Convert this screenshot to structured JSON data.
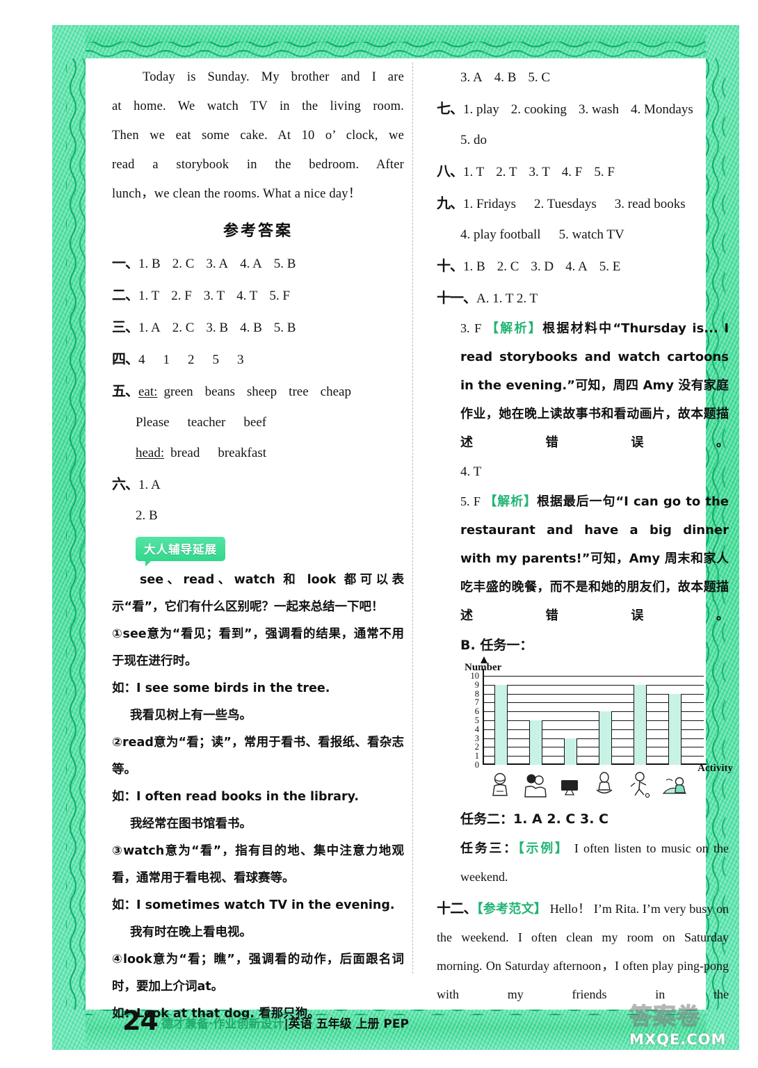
{
  "page": {
    "number": "24",
    "footer_green": "德才兼备·作业创新设计",
    "footer_black": "|英语  五年级  上册  PEP",
    "watermark_cn": "答案卷",
    "watermark_url": "MXQE.COM"
  },
  "reading_passage": {
    "lines": [
      "Today is Sunday. My brother and I are",
      "at home. We watch TV in the living room.",
      "Then we eat some cake. At 10 o’ clock, we",
      "read a storybook in the bedroom. After",
      "lunch，we clean the rooms. What a nice day！"
    ]
  },
  "answer_key": {
    "title": "参考答案",
    "sections": [
      {
        "num": "一、",
        "items": [
          "1. B",
          "2. C",
          "3. A",
          "4. A",
          "5. B"
        ]
      },
      {
        "num": "二、",
        "items": [
          "1. T",
          "2. F",
          "3. T",
          "4. T",
          "5. F"
        ]
      },
      {
        "num": "三、",
        "items": [
          "1. A",
          "2. C",
          "3. B",
          "4. B",
          "5. B"
        ]
      },
      {
        "num": "四、",
        "items": [
          "4",
          "1",
          "2",
          "5",
          "3"
        ]
      }
    ],
    "section_five": {
      "num": "五、",
      "line1_key": "eat:",
      "line1_words": [
        "green",
        "beans",
        "sheep",
        "tree",
        "cheap"
      ],
      "line2_words": [
        "Please",
        "teacher",
        "beef"
      ],
      "line3_key": "head:",
      "line3_words": [
        "bread",
        "breakfast"
      ]
    },
    "section_six": {
      "num": "六、",
      "item1": "1. A",
      "item2": "2. B"
    }
  },
  "tip_box": {
    "banner": "大人辅导延展",
    "paragraphs": [
      "see、read、watch 和 look 都可以表示“看”，它们有什么区别呢？一起来总结一下吧！",
      "①see意为“看见；看到”，强调看的结果，通常不用于现在进行时。",
      "如：I see some birds in the tree.",
      "我看见树上有一些鸟。",
      "②read意为“看；读”，常用于看书、看报纸、看杂志等。",
      "如：I often read books in the library.",
      "我经常在图书馆看书。",
      "③watch意为“看”，指有目的地、集中注意力地观看，通常用于看电视、看球赛等。",
      "如：I sometimes watch TV in the evening.",
      "我有时在晚上看电视。",
      "④look意为“看；瞧”，强调看的动作，后面跟名词时，要加上介词at。",
      "如：Look at that dog. 看那只狗。"
    ]
  },
  "right_column": {
    "six_cont": [
      "3. A",
      "4. B",
      "5. C"
    ],
    "sections": [
      {
        "num": "七、",
        "items": [
          "1. play",
          "2. cooking",
          "3. wash",
          "4. Mondays"
        ],
        "items2": [
          "5. do"
        ]
      },
      {
        "num": "八、",
        "items": [
          "1. T",
          "2. T",
          "3. T",
          "4. F",
          "5. F"
        ]
      },
      {
        "num": "九、",
        "items": [
          "1. Fridays",
          "2. Tuesdays",
          "3. read books"
        ],
        "items2": [
          "4. play football",
          "5. watch TV"
        ]
      },
      {
        "num": "十、",
        "items": [
          "1. B",
          "2. C",
          "3. D",
          "4. A",
          "5. E"
        ]
      }
    ],
    "section_eleven": {
      "num": "十一、",
      "part_a": "A. 1. T    2. T",
      "q3_label": "3. F",
      "jiexi_label": "【解析】",
      "q3_text": "根据材料中“Thursday is... I read storybooks and watch cartoons in the evening.”可知，周四 Amy 没有家庭作业，她在晚上读故事书和看动画片，故本题描述错误。",
      "q4": "4. T",
      "q5_label": "5. F",
      "q5_text": "根据最后一句“I can go to the restaurant and have a big dinner with my parents!”可知，Amy 周末和家人吃丰盛的晚餐，而不是和她的朋友们，故本题描述错误。",
      "part_b": "B. 任务一：",
      "task2": "任务二：1. A    2. C    3. C",
      "task3_label": "任务三：",
      "shili_label": "【示例】",
      "task3_text": "I often listen to music on the weekend."
    },
    "section_twelve": {
      "num": "十二、",
      "fanwen_label": "【参考范文】",
      "text": "Hello！ I’m Rita. I’m very busy on the weekend. I often clean my room on Saturday morning. On Saturday afternoon，I often play ping-pong with my friends in the"
    }
  },
  "chart_data": {
    "type": "bar",
    "title": "",
    "ylabel": "Number",
    "xlabel": "Activity",
    "categories": [
      "icon-1",
      "icon-2",
      "icon-3",
      "icon-4",
      "icon-5",
      "icon-6"
    ],
    "values": [
      9,
      5,
      3,
      6,
      9,
      8
    ],
    "ylim": [
      0,
      10
    ],
    "yticks": [
      0,
      1,
      2,
      3,
      4,
      5,
      6,
      7,
      8,
      9,
      10
    ],
    "grid": true,
    "legend": "none",
    "bar_color": "#c8f2e6"
  },
  "colors": {
    "border_green": "#3fdc96",
    "accent_green": "#21b473",
    "banner_green": "#32d88c"
  }
}
